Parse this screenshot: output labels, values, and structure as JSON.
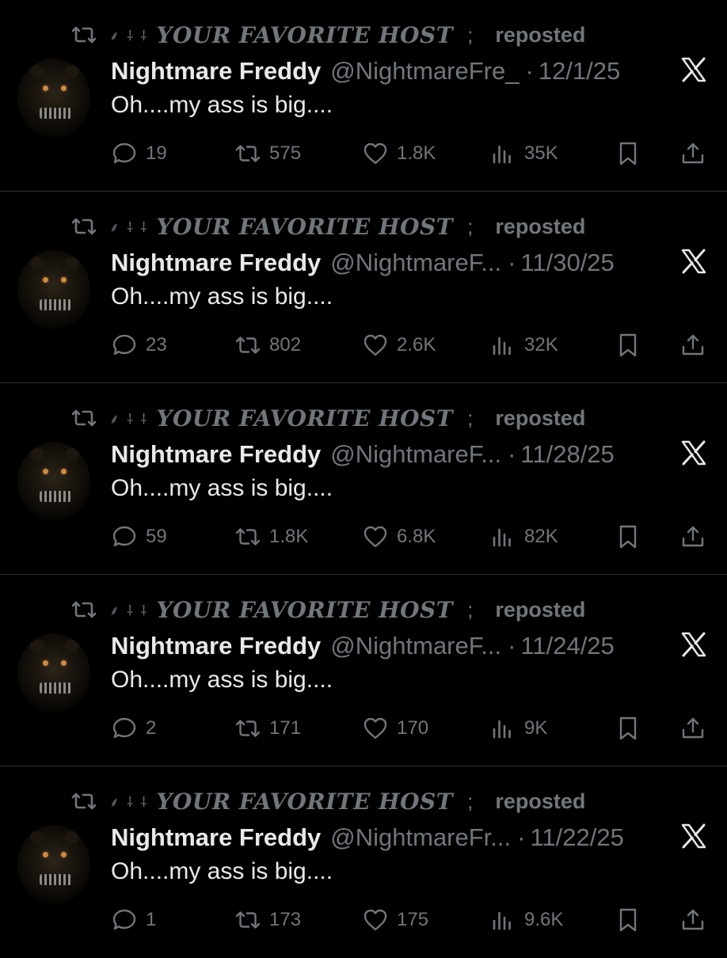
{
  "repost_label": {
    "decoration": "⸙ ⸸ ⸸",
    "host": "YOUR FAVORITE HOST",
    "separator": ";",
    "action": "reposted"
  },
  "author": {
    "name": "Nightmare Freddy",
    "avatar_alt": "Nightmare Freddy avatar"
  },
  "icons": {
    "repost": "repost-icon",
    "reply": "reply-icon",
    "retweet": "retweet-icon",
    "like": "heart-icon",
    "views": "views-icon",
    "bookmark": "bookmark-icon",
    "share": "share-icon",
    "platform": "x-logo-icon"
  },
  "colors": {
    "background": "#000000",
    "primary_text": "#e7e9ea",
    "secondary_text": "#71767b",
    "divider": "#2f3336"
  },
  "tweets": [
    {
      "handle": "@NightmareFre_",
      "separator": "·",
      "date": "12/1/25",
      "text": "Oh....my ass is big....",
      "replies": "19",
      "reposts": "575",
      "likes": "1.8K",
      "views": "35K"
    },
    {
      "handle": "@NightmareF...",
      "separator": "·",
      "date": "11/30/25",
      "text": "Oh....my ass is big....",
      "replies": "23",
      "reposts": "802",
      "likes": "2.6K",
      "views": "32K"
    },
    {
      "handle": "@NightmareF...",
      "separator": "·",
      "date": "11/28/25",
      "text": "Oh....my ass is big....",
      "replies": "59",
      "reposts": "1.8K",
      "likes": "6.8K",
      "views": "82K"
    },
    {
      "handle": "@NightmareF...",
      "separator": "·",
      "date": "11/24/25",
      "text": "Oh....my ass is big....",
      "replies": "2",
      "reposts": "171",
      "likes": "170",
      "views": "9K"
    },
    {
      "handle": "@NightmareFr...",
      "separator": "·",
      "date": "11/22/25",
      "text": "Oh....my ass is big....",
      "replies": "1",
      "reposts": "173",
      "likes": "175",
      "views": "9.6K"
    }
  ]
}
